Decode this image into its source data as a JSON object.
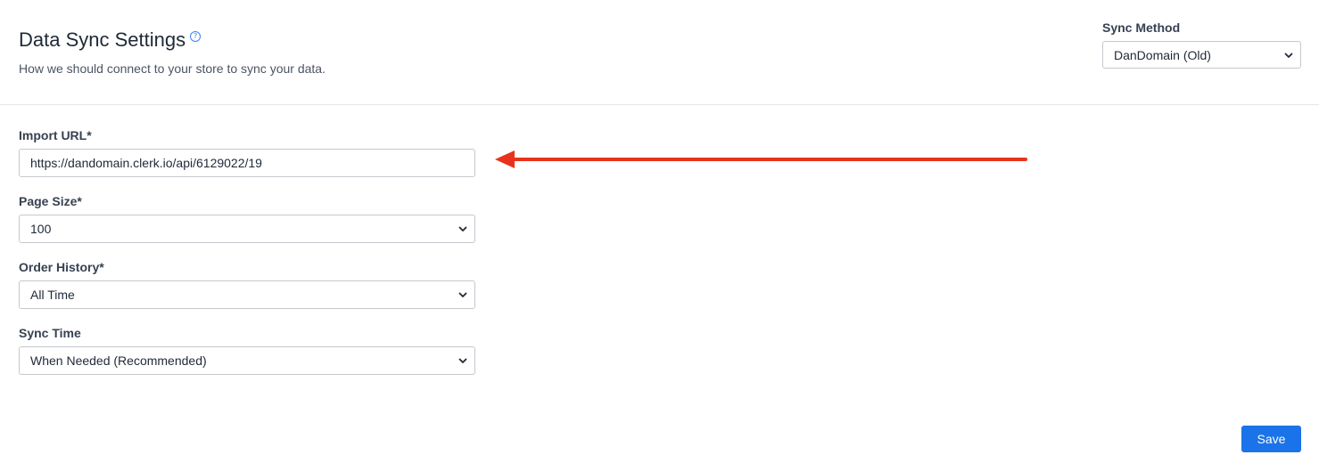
{
  "header": {
    "title": "Data Sync Settings",
    "help_icon": "question-circle-icon",
    "subtitle": "How we should connect to your store to sync your data."
  },
  "sync_method": {
    "label": "Sync Method",
    "selected": "DanDomain (Old)"
  },
  "form": {
    "import_url": {
      "label": "Import URL*",
      "value": "https://dandomain.clerk.io/api/6129022/19"
    },
    "page_size": {
      "label": "Page Size*",
      "selected": "100"
    },
    "order_history": {
      "label": "Order History*",
      "selected": "All Time"
    },
    "sync_time": {
      "label": "Sync Time",
      "selected": "When Needed (Recommended)"
    }
  },
  "save_label": "Save",
  "annotation": {
    "icon": "left-arrow-icon",
    "color": "#e8321c"
  },
  "colors": {
    "accent": "#1a73e8",
    "help_icon": "#3b82f6"
  }
}
